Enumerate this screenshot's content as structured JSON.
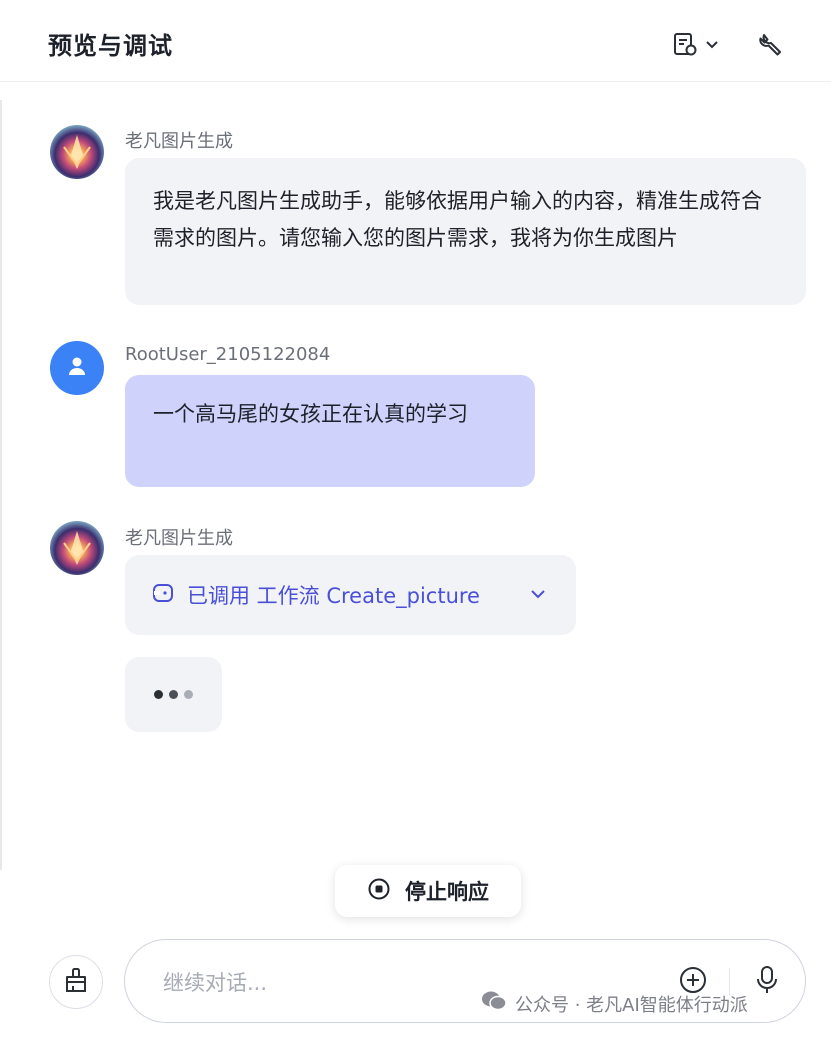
{
  "header": {
    "title": "预览与调试"
  },
  "messages": [
    {
      "sender": "老凡图片生成",
      "text": "我是老凡图片生成助手，能够依据用户输入的内容，精准生成符合需求的图片。请您输入您的图片需求，我将为你生成图片"
    },
    {
      "sender": "RootUser_2105122084",
      "text": "一个高马尾的女孩正在认真的学习"
    },
    {
      "sender": "老凡图片生成",
      "workflow_label": "已调用 工作流 Create_picture"
    }
  ],
  "stop_button": {
    "label": "停止响应"
  },
  "input": {
    "placeholder": "继续对话..."
  },
  "watermark": {
    "text": "公众号 · 老凡AI智能体行动派"
  },
  "colors": {
    "accent": "#4a4fd8",
    "user_bubble": "#cfd3fc",
    "bot_bubble": "#f2f3f6",
    "user_avatar": "#3b82f6"
  }
}
